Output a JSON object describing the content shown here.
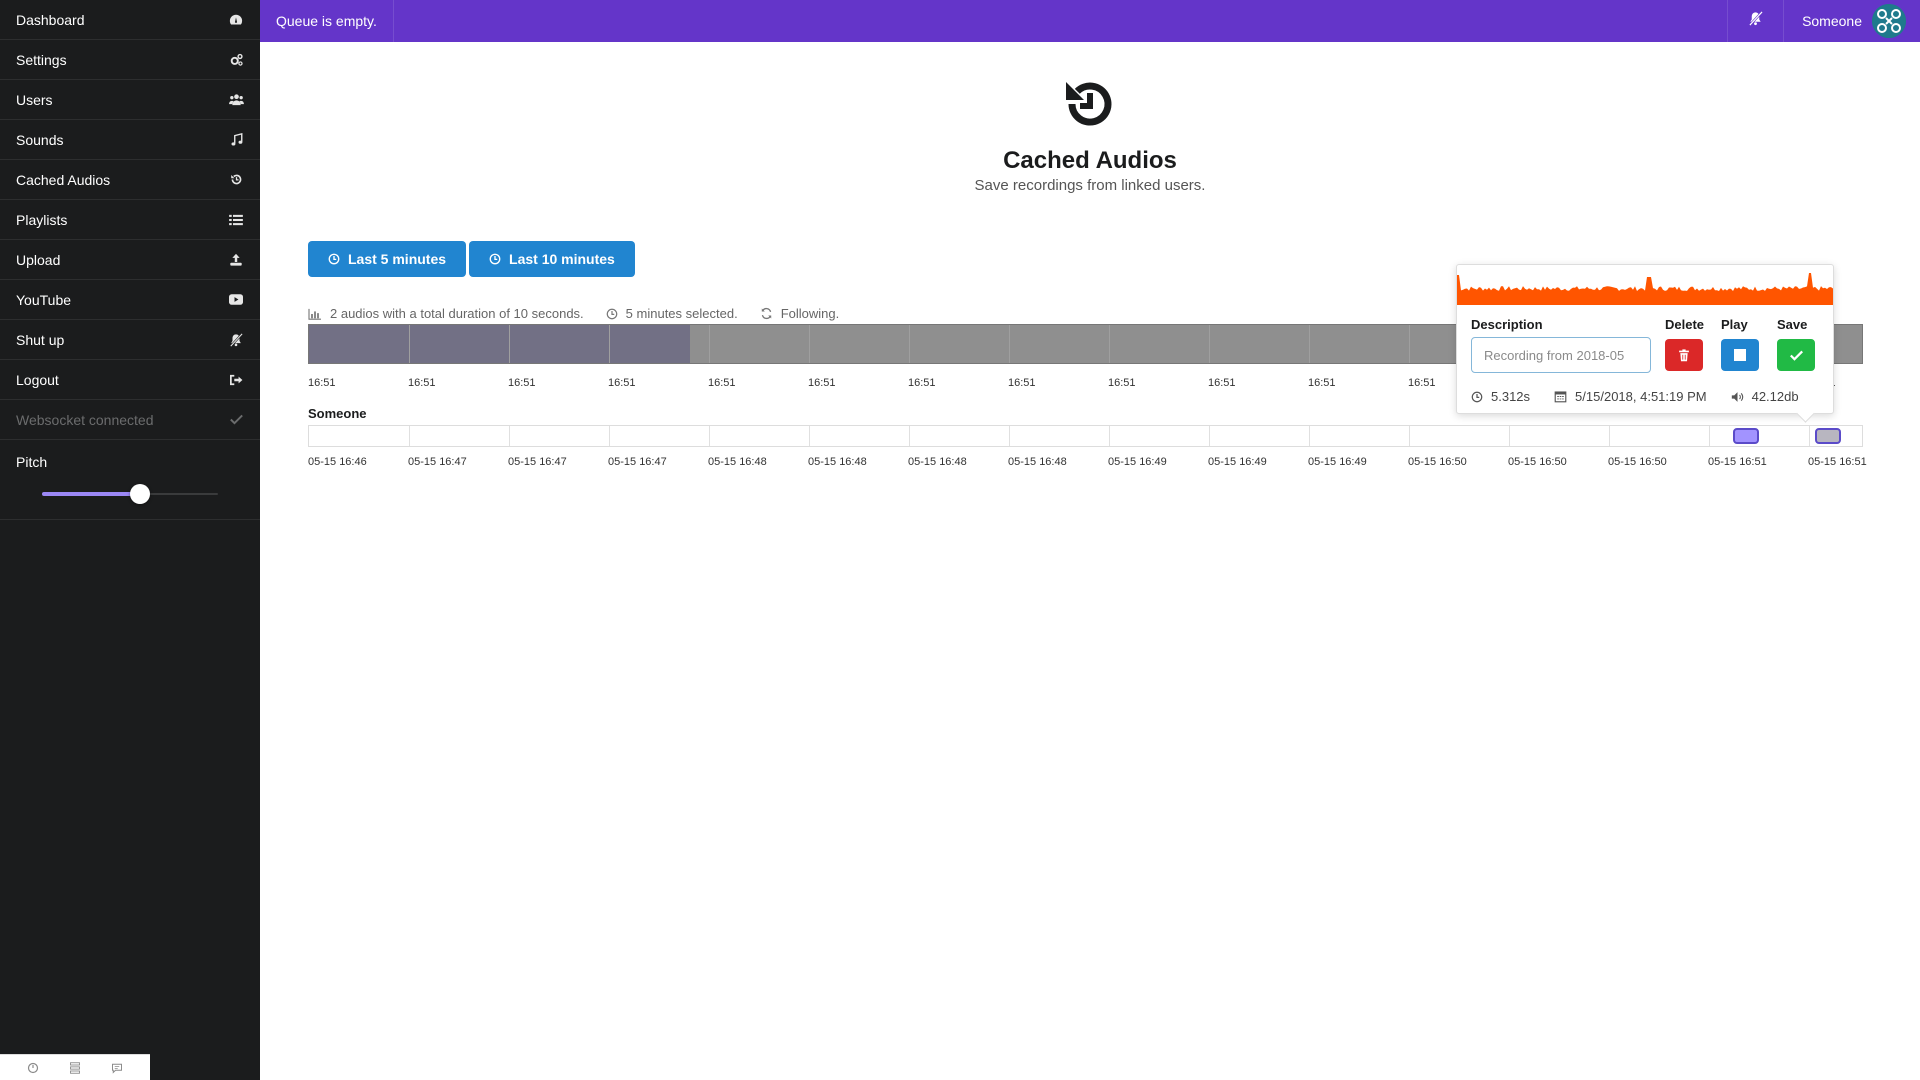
{
  "sidebar": {
    "items": [
      {
        "label": "Dashboard",
        "icon": "dashboard-icon"
      },
      {
        "label": "Settings",
        "icon": "gears-icon"
      },
      {
        "label": "Users",
        "icon": "users-icon"
      },
      {
        "label": "Sounds",
        "icon": "music-icon"
      },
      {
        "label": "Cached Audios",
        "icon": "history-icon"
      },
      {
        "label": "Playlists",
        "icon": "list-icon"
      },
      {
        "label": "Upload",
        "icon": "upload-icon"
      },
      {
        "label": "YouTube",
        "icon": "youtube-icon"
      },
      {
        "label": "Shut up",
        "icon": "bell-slash-icon"
      },
      {
        "label": "Logout",
        "icon": "sign-out-icon"
      }
    ],
    "websocket": {
      "label": "Websocket connected",
      "icon": "check-icon"
    },
    "pitch": {
      "label": "Pitch",
      "value": 0.5
    }
  },
  "topbar": {
    "queue_text": "Queue is empty.",
    "user_name": "Someone",
    "accent_color": "#6435c9"
  },
  "page": {
    "title": "Cached Audios",
    "subtitle": "Save recordings from linked users."
  },
  "buttons": {
    "last5": "Last 5 minutes",
    "last10": "Last 10 minutes",
    "color": "#2185d0"
  },
  "stats": {
    "summary": "2 audios with a total duration of 10 seconds.",
    "selected": "5 minutes selected.",
    "following": "Following."
  },
  "overview": {
    "selection_fraction": 0.245,
    "ticks": [
      "16:51",
      "16:51",
      "16:51",
      "16:51",
      "16:51",
      "16:51",
      "16:51",
      "16:51",
      "16:51",
      "16:51",
      "16:51",
      "16:51",
      "",
      "",
      "",
      "16:51"
    ]
  },
  "timeline": {
    "user": "Someone",
    "ticks": [
      "05-15 16:46",
      "05-15 16:47",
      "05-15 16:47",
      "05-15 16:47",
      "05-15 16:48",
      "05-15 16:48",
      "05-15 16:48",
      "05-15 16:48",
      "05-15 16:49",
      "05-15 16:49",
      "05-15 16:49",
      "05-15 16:50",
      "05-15 16:50",
      "05-15 16:50",
      "05-15 16:51",
      "05-15 16:51"
    ]
  },
  "popup": {
    "description_label": "Description",
    "delete_label": "Delete",
    "play_label": "Play",
    "save_label": "Save",
    "description_placeholder": "Recording from 2018-05",
    "duration": "5.312s",
    "date": "5/15/2018, 4:51:19 PM",
    "volume": "42.12db",
    "waveform_color": "#ff5500"
  }
}
